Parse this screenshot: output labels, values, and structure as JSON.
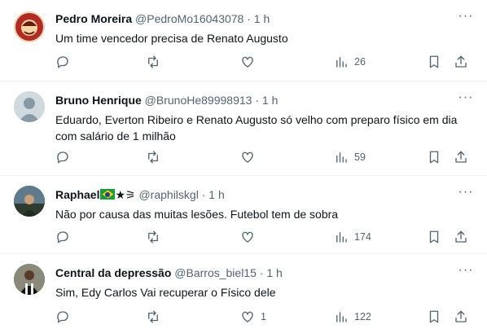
{
  "tweets": [
    {
      "name": "Pedro Moreira",
      "handle": "@PedroMo16043078",
      "separator": "·",
      "time": "1 h",
      "text": "Um time vencedor precisa de Renato Augusto",
      "views": "26",
      "replies": "",
      "retweets": "",
      "likes": ""
    },
    {
      "name": "Bruno Henrique",
      "handle": "@BrunoHe89998913",
      "separator": "·",
      "time": "1 h",
      "text": "Eduardo, Everton Ribeiro e Renato Augusto só velho com preparo físico em dia com salário de 1 milhão",
      "views": "59",
      "replies": "",
      "retweets": "",
      "likes": ""
    },
    {
      "name": "Raphael",
      "name_suffix": "★⚞",
      "handle": "@raphilskgl",
      "separator": "·",
      "time": "1 h",
      "text": "Não por causa das muitas lesões. Futebol tem de sobra",
      "views": "174",
      "replies": "",
      "retweets": "",
      "likes": ""
    },
    {
      "name": "Central da depressão",
      "handle": "@Barros_biel15",
      "separator": "·",
      "time": "1 h",
      "text": "Sim, Edy Carlos Vai recuperar o Físico dele",
      "views": "122",
      "replies": "",
      "retweets": "",
      "likes": "1"
    }
  ],
  "more_glyph": "···",
  "colors": {
    "text": "#0f1419",
    "secondary": "#536471",
    "divider": "#eff3f4"
  }
}
